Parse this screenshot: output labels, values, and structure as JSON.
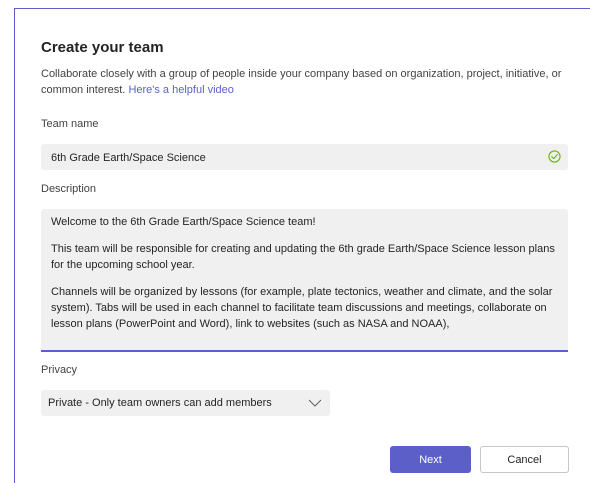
{
  "dialog": {
    "title": "Create your team",
    "subtitle": "Collaborate closely with a group of people inside your company based on organization, project, initiative, or common interest.",
    "video_link": "Here's a helpful video"
  },
  "team_name": {
    "label": "Team name",
    "value": "6th Grade Earth/Space Science",
    "valid_icon": "check-circle-icon"
  },
  "description": {
    "label": "Description",
    "paragraphs": [
      "Welcome to the 6th Grade Earth/Space Science team!",
      "This team will be responsible for creating and updating the 6th grade Earth/Space Science lesson plans for the upcoming school year.",
      "Channels will be organized by lessons (for example, plate tectonics, weather and climate, and the solar system). Tabs will be used in each channel to facilitate team discussions and meetings, collaborate on lesson plans (PowerPoint and Word), link to websites (such as NASA and NOAA),"
    ]
  },
  "privacy": {
    "label": "Privacy",
    "selected": "Private - Only team owners can add members",
    "dropdown_icon": "chevron-down-icon"
  },
  "buttons": {
    "next": "Next",
    "cancel": "Cancel"
  },
  "colors": {
    "accent": "#5b5fc7",
    "valid_green": "#6bb700",
    "field_bg": "#f0f0f0"
  }
}
